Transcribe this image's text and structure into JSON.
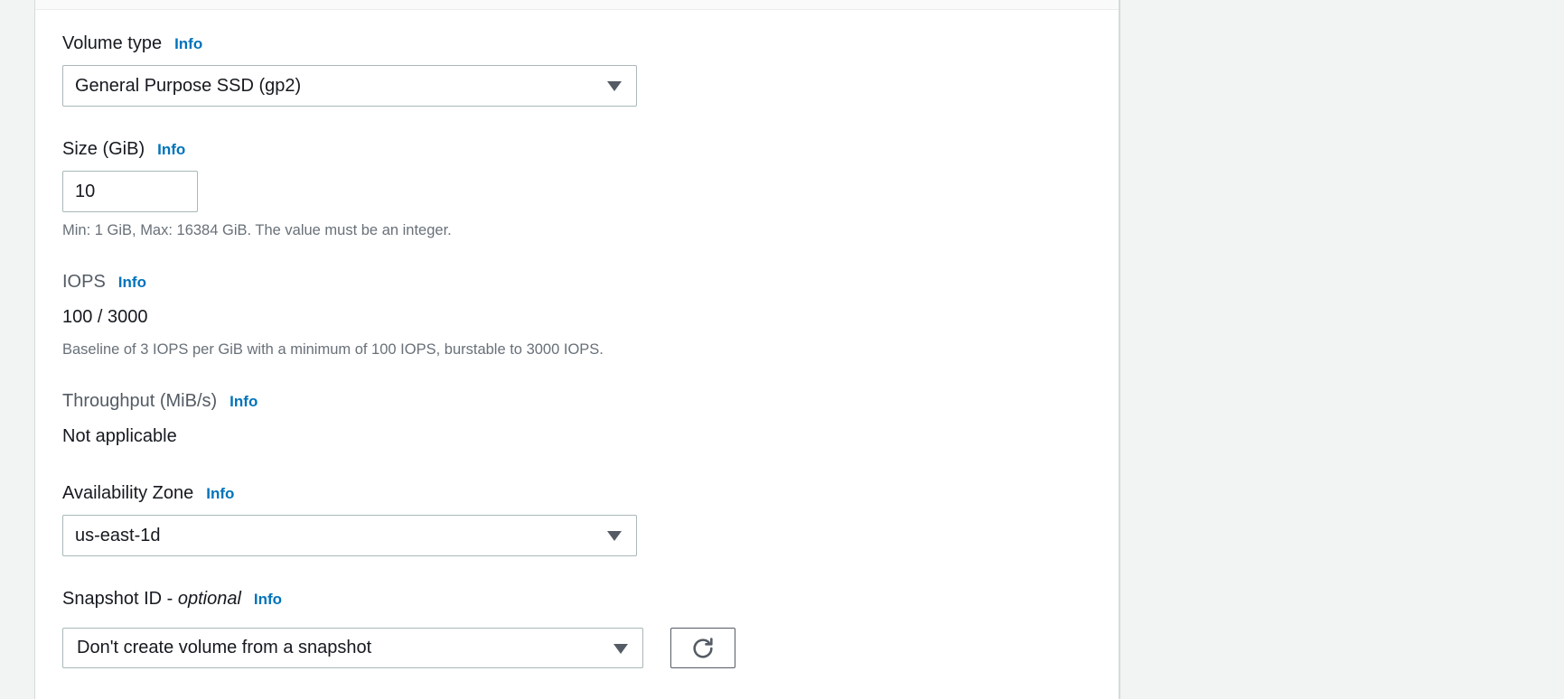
{
  "volume_type": {
    "label": "Volume type",
    "info": "Info",
    "selected": "General Purpose SSD (gp2)"
  },
  "size": {
    "label": "Size (GiB)",
    "info": "Info",
    "value": "10",
    "hint": "Min: 1 GiB, Max: 16384 GiB. The value must be an integer."
  },
  "iops": {
    "label": "IOPS",
    "info": "Info",
    "value": "100 / 3000",
    "hint": "Baseline of 3 IOPS per GiB with a minimum of 100 IOPS, burstable to 3000 IOPS."
  },
  "throughput": {
    "label": "Throughput (MiB/s)",
    "info": "Info",
    "value": "Not applicable"
  },
  "availability_zone": {
    "label": "Availability Zone",
    "info": "Info",
    "selected": "us-east-1d"
  },
  "snapshot": {
    "label": "Snapshot ID - ",
    "label_optional": "optional",
    "info": "Info",
    "selected": "Don't create volume from a snapshot",
    "refresh_icon": "refresh-icon"
  },
  "colors": {
    "link": "#0073bb",
    "text": "#16191f",
    "hint": "#687078",
    "border": "#aab7b8",
    "background": "#f2f3f3"
  }
}
